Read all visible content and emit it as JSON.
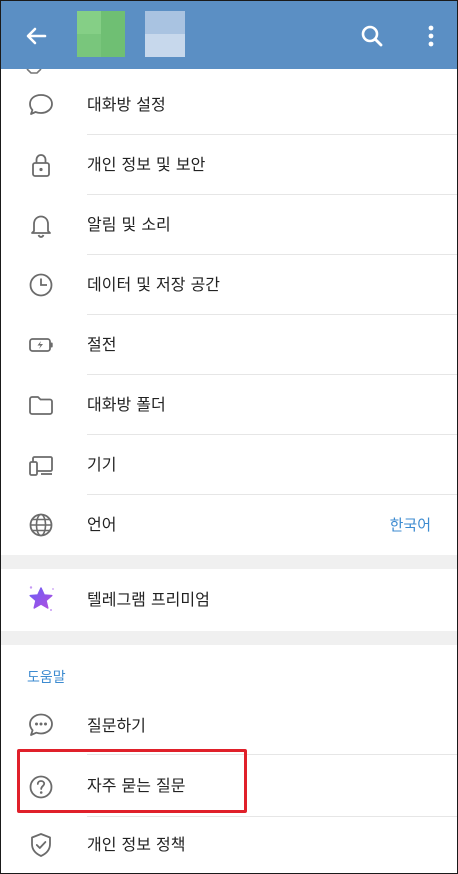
{
  "topbar": {
    "back_icon": "arrow-left-icon",
    "search_icon": "search-icon",
    "more_icon": "more-vertical-icon"
  },
  "settings": [
    {
      "label": "대화방 설정",
      "icon": "chat-bubble-icon"
    },
    {
      "label": "개인 정보 및 보안",
      "icon": "lock-icon"
    },
    {
      "label": "알림 및 소리",
      "icon": "bell-icon"
    },
    {
      "label": "데이터 및 저장 공간",
      "icon": "clock-icon"
    },
    {
      "label": "절전",
      "icon": "battery-icon"
    },
    {
      "label": "대화방 폴더",
      "icon": "folder-icon"
    },
    {
      "label": "기기",
      "icon": "devices-icon"
    },
    {
      "label": "언어",
      "icon": "globe-icon",
      "value": "한국어"
    }
  ],
  "premium": {
    "label": "텔레그램 프리미엄",
    "icon": "star-icon"
  },
  "help": {
    "header": "도움말",
    "items": [
      {
        "label": "질문하기",
        "icon": "chat-dots-icon"
      },
      {
        "label": "자주 묻는 질문",
        "icon": "question-icon"
      },
      {
        "label": "개인 정보 정책",
        "icon": "shield-check-icon"
      }
    ]
  },
  "colors": {
    "header_bg": "#5b8fc4",
    "accent": "#3d8bd0",
    "highlight": "#e0202a",
    "premium_star": "#8a5cf6"
  }
}
